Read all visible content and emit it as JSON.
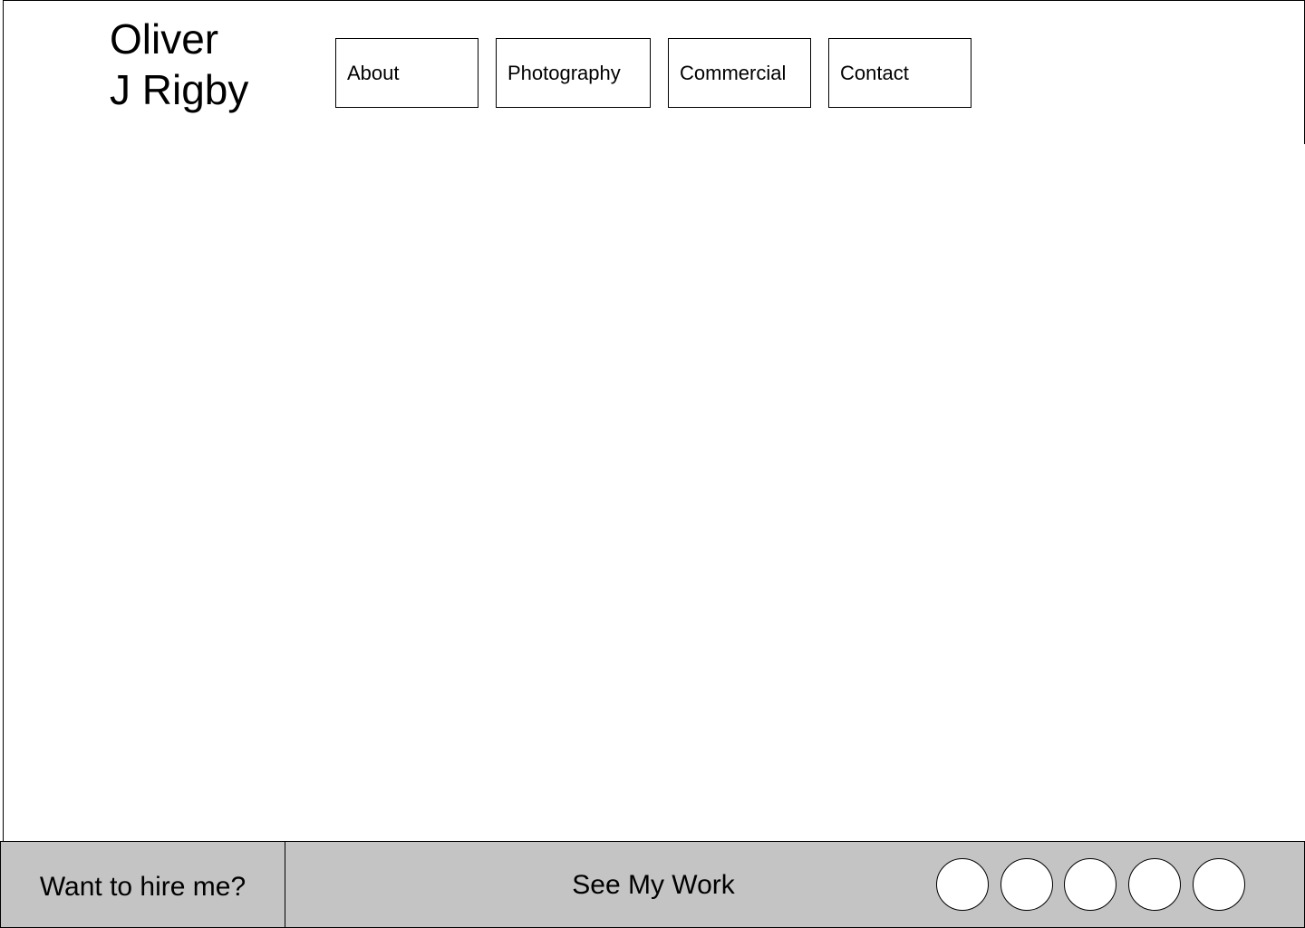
{
  "header": {
    "brand_line1": "Oliver",
    "brand_line2": "J Rigby",
    "nav": {
      "about": "About",
      "photography": "Photography",
      "commercial": "Commercial",
      "contact": "Contact"
    }
  },
  "footer": {
    "hire_label": "Want to hire me?",
    "see_work_label": "See My Work",
    "social_icons": [
      "social-placeholder-icon",
      "social-placeholder-icon",
      "social-placeholder-icon",
      "social-placeholder-icon",
      "social-placeholder-icon"
    ]
  },
  "colors": {
    "footer_background": "#c4c4c4",
    "border": "#000000",
    "background": "#ffffff"
  }
}
